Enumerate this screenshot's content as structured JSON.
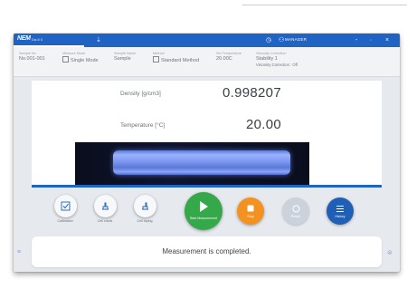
{
  "window": {
    "logo": "NEM",
    "app_name": "Da-6 0",
    "user": "MANAGER",
    "icons": [
      "usb-icon",
      "clock-icon",
      "user-icon",
      "minimize-icon",
      "maximize-icon",
      "close-icon"
    ]
  },
  "info": [
    {
      "key": "Sample No",
      "value": "No.001-001"
    },
    {
      "key": "Measure Mode",
      "value": "Single Mode"
    },
    {
      "key": "Sample Name",
      "value": "Sample"
    },
    {
      "key": "Method",
      "value": "Standard Method"
    },
    {
      "key": "Set Temperature",
      "value": "20.00C"
    },
    {
      "key": "Viscosity Correction",
      "value": "Stability 1"
    },
    {
      "key": "",
      "value": "Viscosity Correction : Off"
    }
  ],
  "measurement": {
    "density_label": "Density [g/cm3]",
    "density_value": "0.998207",
    "temp_label": "Temperature [°C]",
    "temp_value": "20.00",
    "progress": 1.0
  },
  "buttons": {
    "calibration": "Calibration",
    "cell_check": "Cell check",
    "cell_drying": "Cell drying",
    "start": "Start Measurement",
    "stop": "Stop",
    "result": "Result",
    "history": "History"
  },
  "status": {
    "message": "Measurement is completed."
  },
  "colors": {
    "titlebar": "#1f63c4",
    "start": "#35a84a",
    "stop": "#f39221",
    "history": "#1f5fb5"
  }
}
